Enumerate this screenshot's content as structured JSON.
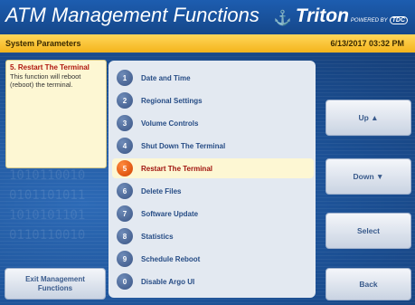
{
  "header": {
    "title": "ATM Management Functions",
    "brand": "Triton",
    "brand_sub": "POWERED BY",
    "brand_mark": "TDC"
  },
  "status": {
    "section": "System Parameters",
    "datetime": "6/13/2017  03:32 PM"
  },
  "info": {
    "title": "5. Restart The Terminal",
    "description": "This function will reboot (reboot) the terminal."
  },
  "menu": {
    "items": [
      {
        "num": "1",
        "label": "Date and Time"
      },
      {
        "num": "2",
        "label": "Regional Settings"
      },
      {
        "num": "3",
        "label": "Volume Controls"
      },
      {
        "num": "4",
        "label": "Shut Down The Terminal"
      },
      {
        "num": "5",
        "label": "Restart The Terminal"
      },
      {
        "num": "6",
        "label": "Delete Files"
      },
      {
        "num": "7",
        "label": "Software Update"
      },
      {
        "num": "8",
        "label": "Statistics"
      },
      {
        "num": "9",
        "label": "Schedule Reboot"
      },
      {
        "num": "0",
        "label": "Disable Argo UI"
      }
    ],
    "selected_index": 4
  },
  "buttons": {
    "up": "Up ▲",
    "down": "Down ▼",
    "select": "Select",
    "back": "Back",
    "exit": "Exit Management Functions"
  },
  "decor": {
    "binary": "1010110010\n0101101011\n1010101101\n0110110010"
  },
  "colors": {
    "header_blue": "#1b4f93",
    "status_yellow": "#f4b41c",
    "selected_highlight": "#fdf7d3",
    "selected_number": "#e05a00"
  }
}
